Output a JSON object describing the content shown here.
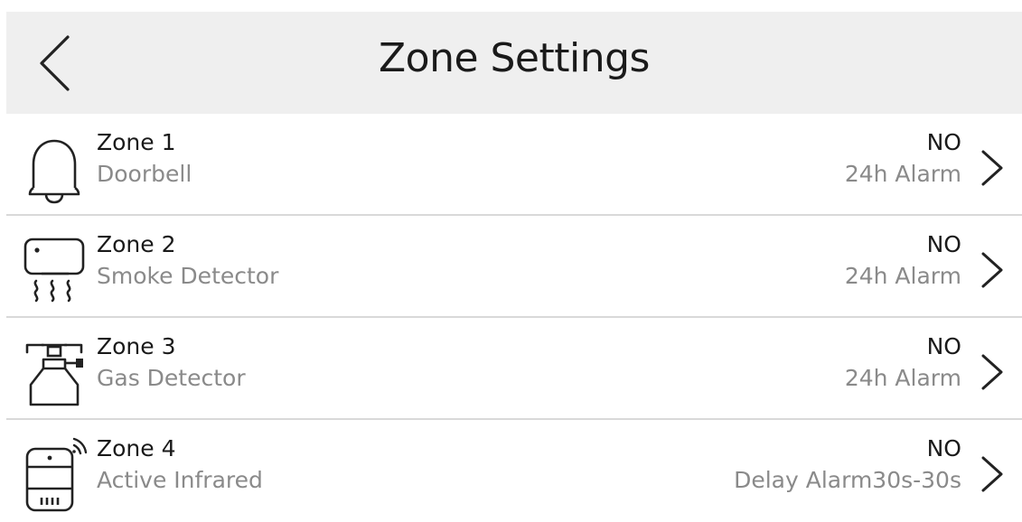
{
  "header": {
    "title": "Zone Settings",
    "back_icon": "chevron-left-icon"
  },
  "zones": [
    {
      "name": "Zone 1",
      "type": "Doorbell",
      "state": "NO",
      "alarm": "24h Alarm",
      "icon": "doorbell-icon"
    },
    {
      "name": "Zone 2",
      "type": "Smoke Detector",
      "state": "NO",
      "alarm": "24h Alarm",
      "icon": "smoke-detector-icon"
    },
    {
      "name": "Zone 3",
      "type": "Gas Detector",
      "state": "NO",
      "alarm": "24h Alarm",
      "icon": "gas-detector-icon"
    },
    {
      "name": "Zone 4",
      "type": "Active Infrared",
      "state": "NO",
      "alarm": "Delay Alarm30s-30s",
      "icon": "active-infrared-icon"
    }
  ],
  "colors": {
    "header_bg": "#efefef",
    "primary_text": "#1a1a1a",
    "secondary_text": "#8a8a8a",
    "divider": "#d9d9d9",
    "icon_stroke": "#222222"
  }
}
